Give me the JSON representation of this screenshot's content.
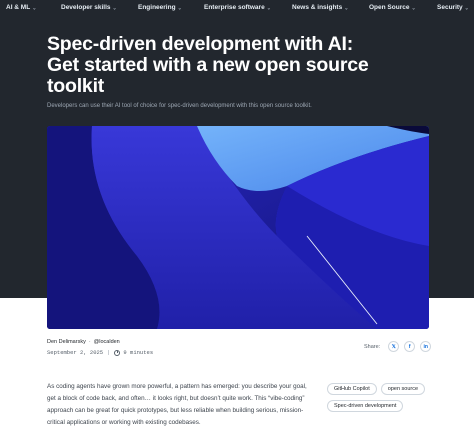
{
  "nav": {
    "items": [
      {
        "label": "AI & ML"
      },
      {
        "label": "Developer skills"
      },
      {
        "label": "Engineering"
      },
      {
        "label": "Enterprise software"
      },
      {
        "label": "News & insights"
      },
      {
        "label": "Open Source"
      },
      {
        "label": "Security"
      }
    ],
    "chevron": "⌄"
  },
  "article": {
    "title": "Spec-driven development with AI: Get started with a new open source toolkit",
    "subtitle": "Developers can use their AI tool of choice for spec-driven development with this open source toolkit.",
    "author": "Den Delimarsky",
    "author_handle": "@localden",
    "date": "September 2, 2025",
    "read_time": "9 minutes",
    "body": "As coding agents have grown more powerful, a pattern has emerged: you describe your goal, get a block of code back, and often… it looks right, but doesn’t quite work. This “vibe-coding” approach can be great for quick prototypes, but less reliable when building serious, mission-critical applications or working with existing codebases."
  },
  "share": {
    "label": "Share:",
    "buttons": [
      {
        "icon": "x-icon",
        "glyph": "𝕏"
      },
      {
        "icon": "facebook-icon",
        "glyph": "f"
      },
      {
        "icon": "linkedin-icon",
        "glyph": "in"
      }
    ]
  },
  "tags": [
    "GitHub Copilot",
    "open source",
    "Spec-driven development"
  ],
  "colors": {
    "dark_bg": "#22272e",
    "hero_deep": "#1a1a8a",
    "hero_light": "#5b9cf2"
  }
}
